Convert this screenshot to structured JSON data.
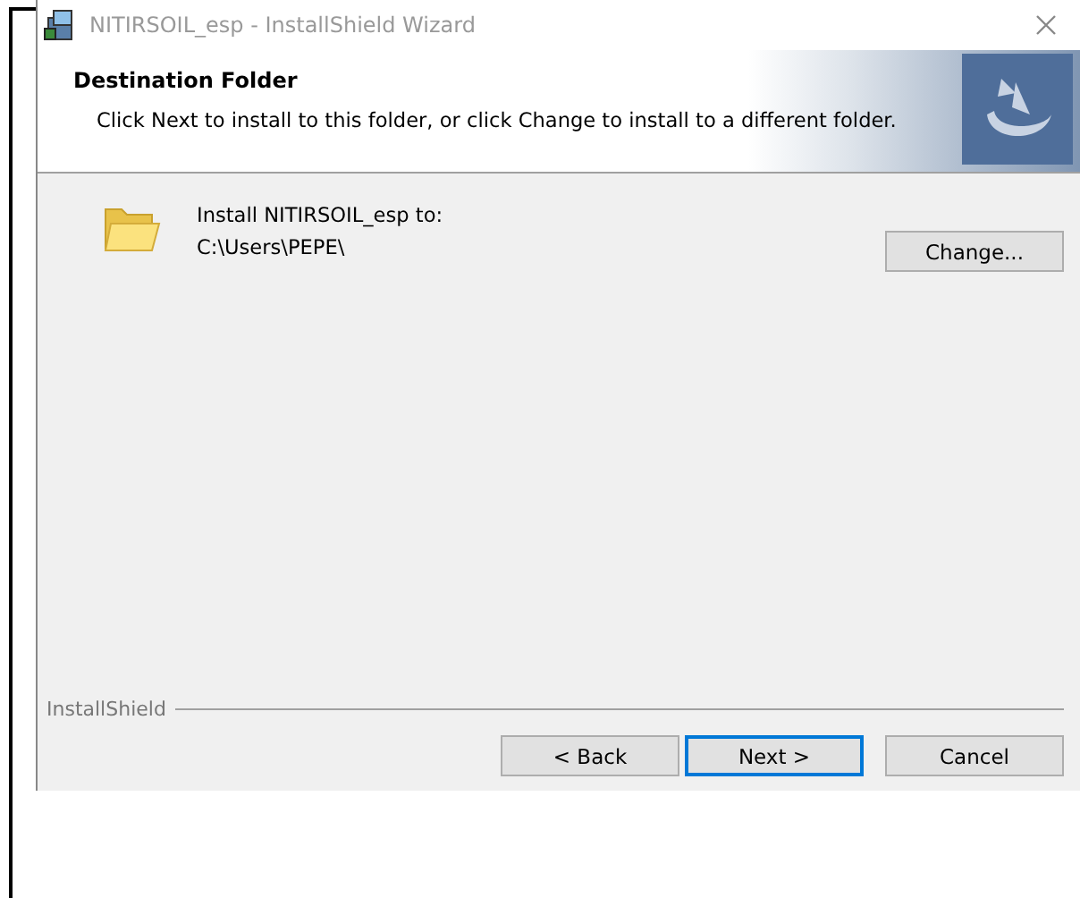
{
  "window": {
    "title": "NITIRSOIL_esp - InstallShield Wizard"
  },
  "header": {
    "title": "Destination Folder",
    "description": "Click Next to install to this folder, or click Change to install to a different folder."
  },
  "destination": {
    "label": "Install NITIRSOIL_esp to:",
    "path": "C:\\Users\\PEPE\\",
    "change_button": "Change..."
  },
  "brand": "InstallShield",
  "buttons": [
    {
      "label": "< Back",
      "focused": false
    },
    {
      "label": "Next >",
      "focused": true
    },
    {
      "label": "Cancel",
      "focused": false
    }
  ]
}
